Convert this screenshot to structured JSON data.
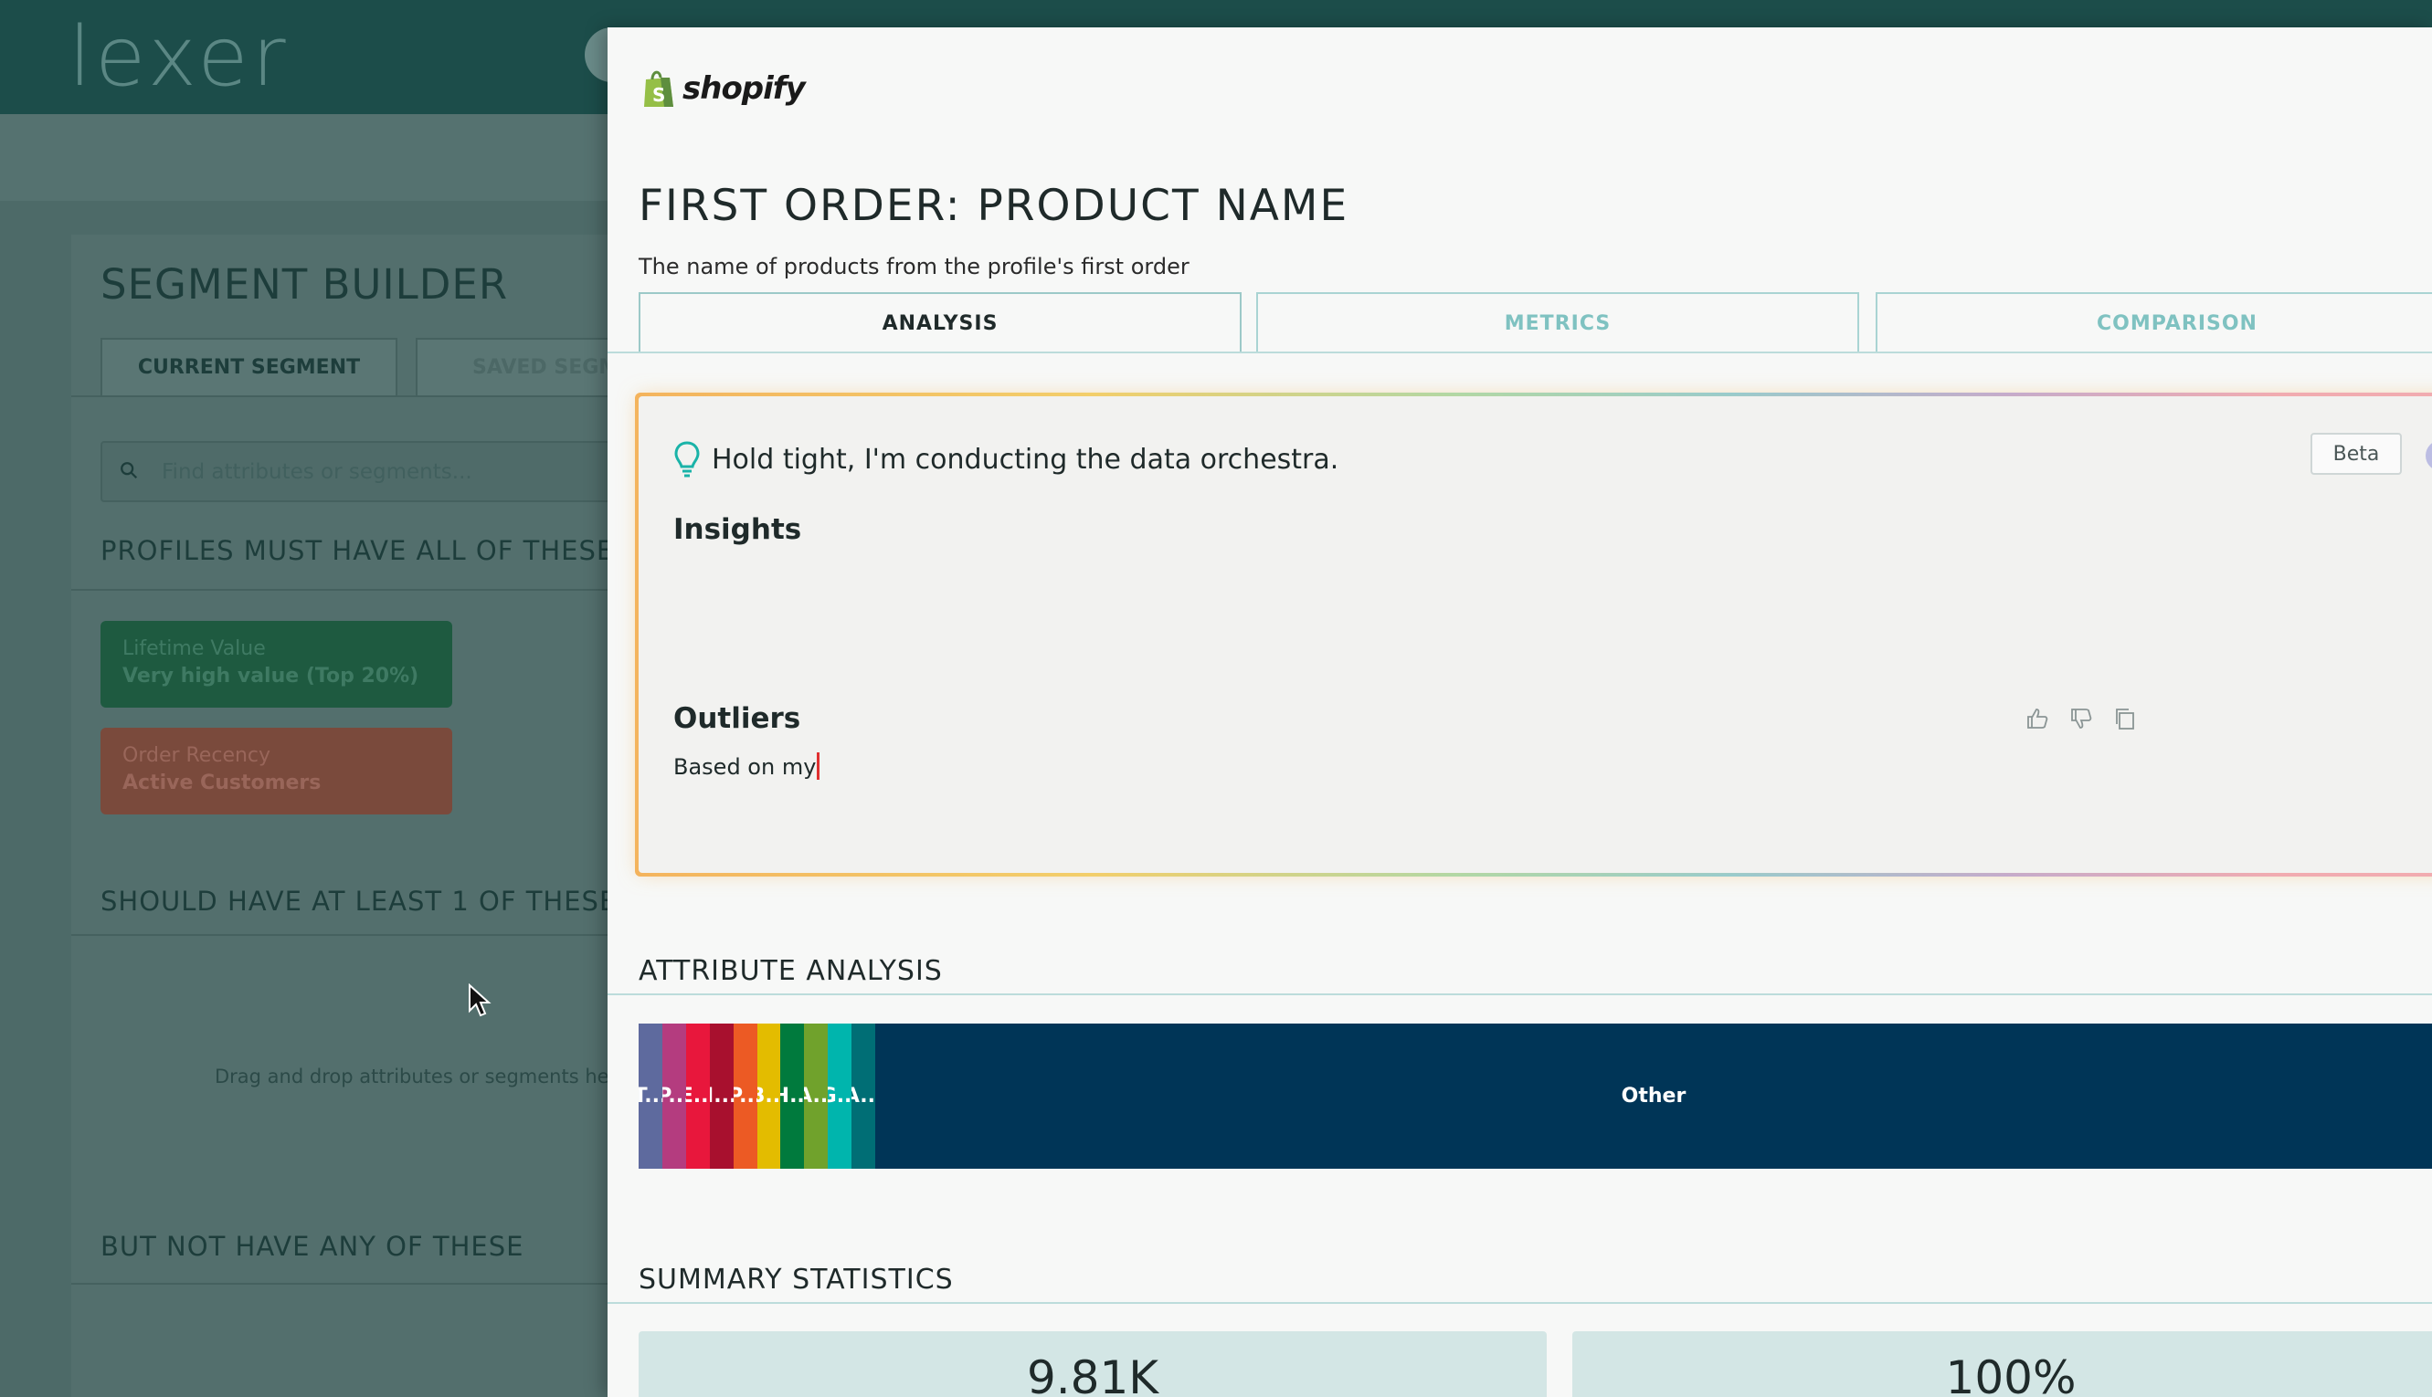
{
  "background": {
    "logo": "lexer",
    "segment_builder": {
      "title": "SEGMENT BUILDER",
      "tabs": [
        "CURRENT SEGMENT",
        "SAVED SEGME"
      ],
      "search_placeholder": "Find attributes or segments...",
      "must_heading": "PROFILES MUST HAVE ALL OF THESE",
      "chips": [
        {
          "label": "Lifetime Value",
          "value": "Very high value (Top 20%)",
          "color": "#1e5a40"
        },
        {
          "label": "Order Recency",
          "value": "Active Customers",
          "color": "#7a4a3c"
        }
      ],
      "should_heading": "SHOULD HAVE AT LEAST 1 OF THESE",
      "drop_hint": "Drag and drop attributes or segments here",
      "not_heading": "BUT NOT HAVE ANY OF THESE"
    }
  },
  "modal": {
    "source": "shopify",
    "title": "FIRST ORDER: PRODUCT NAME",
    "subtitle": "The name of products from the profile's first order",
    "tabs": [
      "ANALYSIS",
      "METRICS",
      "COMPARISON"
    ],
    "active_tab": "ANALYSIS",
    "ai_card": {
      "status": "Hold tight, I'm conducting the data orchestra.",
      "badge": "Beta",
      "help": "?",
      "insights_heading": "Insights",
      "outliers_heading": "Outliers",
      "outliers_text": "Based on my",
      "icons": [
        "lightbulb-icon",
        "thumbs-up-icon",
        "thumbs-down-icon",
        "copy-icon",
        "help-icon"
      ]
    },
    "attribute_analysis": {
      "heading": "ATTRIBUTE ANALYSIS",
      "segments": [
        {
          "label": "T...",
          "color": "#5e6a9e",
          "share": 0.0132
        },
        {
          "label": "P...",
          "color": "#b43c7f",
          "share": 0.0132
        },
        {
          "label": "E...",
          "color": "#e8173c",
          "share": 0.0132
        },
        {
          "label": "I...",
          "color": "#a8102e",
          "share": 0.0132
        },
        {
          "label": "P...",
          "color": "#ec5a24",
          "share": 0.0132
        },
        {
          "label": "B...",
          "color": "#e3bc00",
          "share": 0.0132
        },
        {
          "label": "H...",
          "color": "#007a3d",
          "share": 0.0132
        },
        {
          "label": "A...",
          "color": "#70a22c",
          "share": 0.0132
        },
        {
          "label": "G...",
          "color": "#00b5ad",
          "share": 0.0132
        },
        {
          "label": "A...",
          "color": "#006e75",
          "share": 0.0132
        },
        {
          "label": "Other",
          "color": "#003557",
          "share": 0.868
        }
      ]
    },
    "summary_statistics": {
      "heading": "SUMMARY STATISTICS",
      "values": [
        "9.81K",
        "100%"
      ]
    }
  }
}
